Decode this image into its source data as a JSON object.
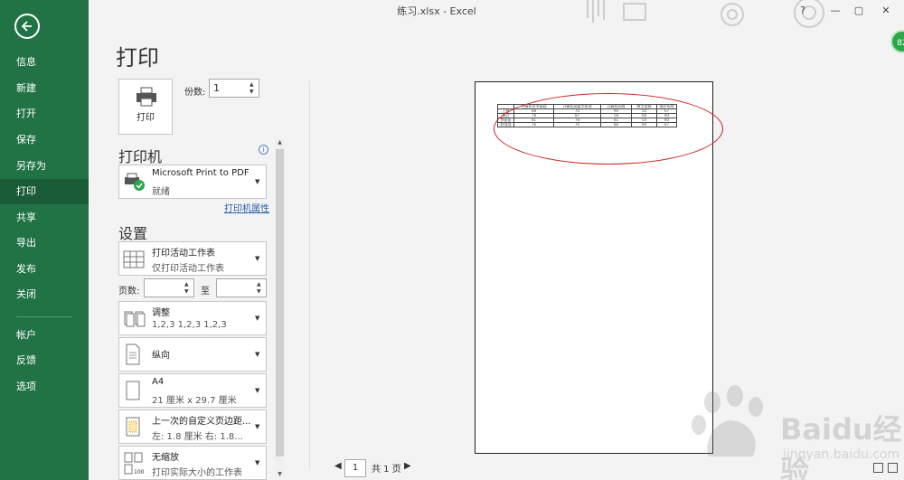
{
  "window": {
    "title": "练习.xlsx  -  Excel",
    "help": "?",
    "min": "—",
    "max": "▢",
    "close": "✕"
  },
  "user_badge": "82",
  "sidebar": {
    "back_icon": "back-arrow-icon",
    "items": [
      {
        "label": "信息"
      },
      {
        "label": "新建"
      },
      {
        "label": "打开"
      },
      {
        "label": "保存"
      },
      {
        "label": "另存为"
      },
      {
        "label": "打印",
        "active": true
      },
      {
        "label": "共享"
      },
      {
        "label": "导出"
      },
      {
        "label": "发布"
      },
      {
        "label": "关闭"
      },
      {
        "label": "帐户"
      },
      {
        "label": "反馈"
      },
      {
        "label": "选项"
      }
    ]
  },
  "page_title": "打印",
  "print_button": {
    "label": "打印",
    "icon": "printer-icon"
  },
  "copies": {
    "label": "份数:",
    "value": "1"
  },
  "printer": {
    "heading": "打印机",
    "name": "Microsoft Print to PDF",
    "status": "就绪",
    "properties_link": "打印机属性"
  },
  "settings": {
    "heading": "设置",
    "scope": {
      "l1": "打印活动工作表",
      "l2": "仅打印活动工作表"
    },
    "pages_label": "页数:",
    "to_label": "至",
    "collate": {
      "l1": "调整",
      "l2": "1,2,3    1,2,3    1,2,3"
    },
    "orientation": {
      "l1": "纵向"
    },
    "paper": {
      "l1": "A4",
      "l2": "21 厘米 x 29.7 厘米"
    },
    "margins": {
      "l1": "上一次的自定义页边距...",
      "l2": "左: 1.8 厘米    右: 1.8..."
    },
    "scaling": {
      "l1": "无缩放",
      "l2": "打印实际大小的工作表"
    }
  },
  "preview": {
    "headers": [
      "",
      "计算机技术基础",
      "计算机高级字原理",
      "计算机网络",
      "数字逻辑",
      "操作系统"
    ],
    "rows": [
      [
        "王磊",
        "88",
        "76",
        "90",
        "56",
        "67"
      ],
      [
        "张红",
        "78",
        "87",
        "58",
        "68",
        "89"
      ],
      [
        "李丽丽",
        "81",
        "78",
        "81",
        "54",
        "80"
      ],
      [
        "赵强强",
        "76",
        "76",
        "86",
        "69",
        "67"
      ]
    ]
  },
  "pager": {
    "current": "1",
    "total_label": "共 1 页",
    "prev": "◀",
    "next": "▶"
  },
  "watermark": {
    "text": "Baidu经验",
    "url": "jingyan.baidu.com"
  },
  "colors": {
    "sidebar": "#217346",
    "active": "#1a5c38",
    "annotation": "#d02020"
  }
}
